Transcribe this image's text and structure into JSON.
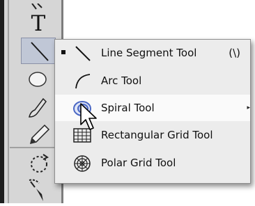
{
  "toolbar": {
    "type_tool_glyph": "T"
  },
  "flyout": {
    "items": [
      {
        "label": "Line Segment Tool",
        "shortcut": "(\\)",
        "checked": true,
        "icon": "line-segment-icon"
      },
      {
        "label": "Arc Tool",
        "icon": "arc-icon"
      },
      {
        "label": "Spiral Tool",
        "icon": "spiral-icon",
        "has_submenu": true,
        "highlighted": true
      },
      {
        "label": "Rectangular Grid Tool",
        "icon": "rectangular-grid-icon"
      },
      {
        "label": "Polar Grid Tool",
        "icon": "polar-grid-icon"
      }
    ]
  },
  "colors": {
    "toolbar_bg": "#d6d6d6",
    "menu_bg": "#ececec",
    "highlight_bg": "#fafafa",
    "selected_tool_bg": "#c0c7d6",
    "spiral_blue": "#4a67c4"
  }
}
